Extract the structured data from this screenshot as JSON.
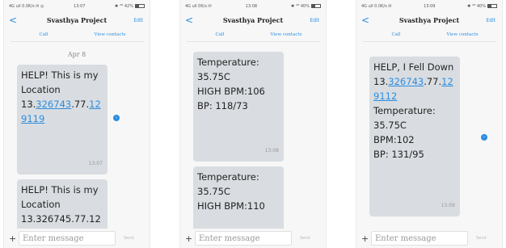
{
  "status": {
    "left": "4G ull 0.0K/s ✉ ◎",
    "time": "13:07",
    "right": "✱ ⁴ᴳ 42%"
  },
  "status2": {
    "left": "4G ull 0K/s ✉",
    "time": "13:08",
    "right": "✱ ⁴ᴳ 40%"
  },
  "status3": {
    "left": "4G ull 0.0K/s ✉",
    "time": "13:09",
    "right": "✱ ⁴ᴳ 40%"
  },
  "header": {
    "back": "<",
    "title": "Svasthya Project",
    "edit": "Edit",
    "call": "Call",
    "view_contacts": "View contacts"
  },
  "composer": {
    "plus": "+",
    "placeholder": "Enter message",
    "send": "Send"
  },
  "screen1": {
    "date": "Apr 8",
    "msg1": {
      "line1": "HELP! This is my",
      "line2": "Location",
      "coord_prefix": "13.",
      "coord_link1": "326743",
      "coord_mid": ".77.",
      "coord_link2": "12",
      "coord_link3": "9119",
      "time": "13:07"
    },
    "msg2": {
      "line1": "HELP! This is my",
      "line2": "Location",
      "line3": "13.326745.77.12"
    }
  },
  "screen2": {
    "msg1": {
      "line1": "Temperature:",
      "line2": "35.75C",
      "line3": "HIGH BPM:106",
      "line4": "BP: 118/73",
      "time": "13:08"
    },
    "msg2": {
      "line1": "Temperature:",
      "line2": "35.75C",
      "line3": "HIGH BPM:110"
    }
  },
  "screen3": {
    "msg1": {
      "line1": "HELP, I Fell Down",
      "coord_prefix": "13.",
      "coord_link1": "326743",
      "coord_mid": ".77.",
      "coord_link2": "12",
      "coord_link3": "9112",
      "line3": "Temperature:",
      "line4": "35.75C",
      "line5": "BPM:102",
      "line6": "BP: 131/95",
      "time": "13:09"
    }
  }
}
